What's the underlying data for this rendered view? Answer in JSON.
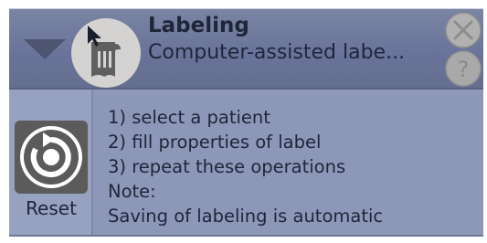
{
  "header": {
    "title": "Labeling",
    "subtitle": "Computer-assisted labe..."
  },
  "icons": {
    "collapse": "triangle-down-icon",
    "module": "labeling-tool-icon",
    "close": "close-icon",
    "help": "help-icon",
    "reset": "reset-icon"
  },
  "reset": {
    "label": "Reset"
  },
  "instructions": {
    "lines": [
      "1) select a patient",
      "2) fill properties of label",
      "3) repeat these operations",
      "Note:",
      "Saving of labeling is automatic"
    ]
  },
  "colors": {
    "panel": "#8d98b9",
    "header": "#6d779a",
    "text": "#20263a"
  }
}
